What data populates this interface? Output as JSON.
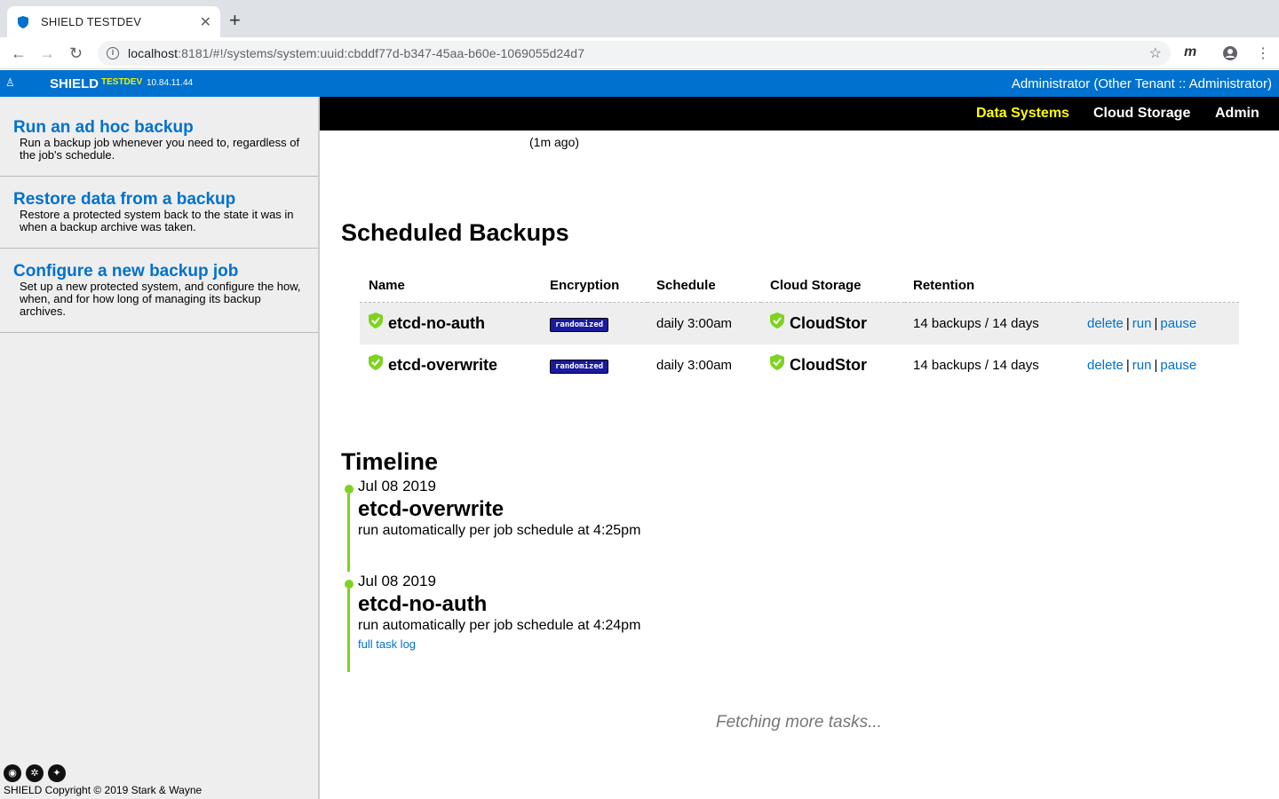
{
  "browser": {
    "tab_title": "SHIELD TESTDEV",
    "new_tab": "+",
    "url_host": "localhost",
    "url_path": ":8181/#!/systems/system:uuid:cbddf77d-b347-45aa-b60e-1069055d24d7",
    "ext_label": "m"
  },
  "header": {
    "brand": "SHIELD",
    "env": "TESTDEV",
    "ip": "10.84.11.44",
    "user": "Administrator (Other Tenant :: Administrator)"
  },
  "sidebar": {
    "items": [
      {
        "title": "Run an ad hoc backup",
        "desc": "Run a backup job whenever you need to, regardless of the job's schedule."
      },
      {
        "title": "Restore data from a backup",
        "desc": "Restore a protected system back to the state it was in when a backup archive was taken."
      },
      {
        "title": "Configure a new backup job",
        "desc": "Set up a new protected system, and configure the how, when, and for how long of managing its backup archives."
      }
    ],
    "copyright": "SHIELD Copyright © 2019 Stark & Wayne"
  },
  "nav": {
    "data_systems": "Data Systems",
    "cloud_storage": "Cloud Storage",
    "admin": "Admin"
  },
  "partial": {
    "ago": "(1m ago)"
  },
  "scheduled": {
    "title": "Scheduled Backups",
    "headers": [
      "Name",
      "Encryption",
      "Schedule",
      "Cloud Storage",
      "Retention"
    ],
    "rows": [
      {
        "name": "etcd-no-auth",
        "encryption": "randomized",
        "schedule": "daily 3:00am",
        "storage": "CloudStor",
        "retention": "14 backups / 14 days",
        "delete": "delete",
        "run": "run",
        "pause": "pause"
      },
      {
        "name": "etcd-overwrite",
        "encryption": "randomized",
        "schedule": "daily 3:00am",
        "storage": "CloudStor",
        "retention": "14 backups / 14 days",
        "delete": "delete",
        "run": "run",
        "pause": "pause"
      }
    ]
  },
  "timeline": {
    "title": "Timeline",
    "entries": [
      {
        "date": "Jul 08 2019",
        "job": "etcd-overwrite",
        "desc": "run automatically per job schedule at 4:25pm"
      },
      {
        "date": "Jul 08 2019",
        "job": "etcd-no-auth",
        "desc": "run automatically per job schedule at 4:24pm",
        "log": "full task log"
      }
    ],
    "fetching": "Fetching more tasks..."
  },
  "colors": {
    "brand_blue": "#0071ce",
    "nav_active": "#ffff00",
    "success_green": "#7ed321"
  }
}
